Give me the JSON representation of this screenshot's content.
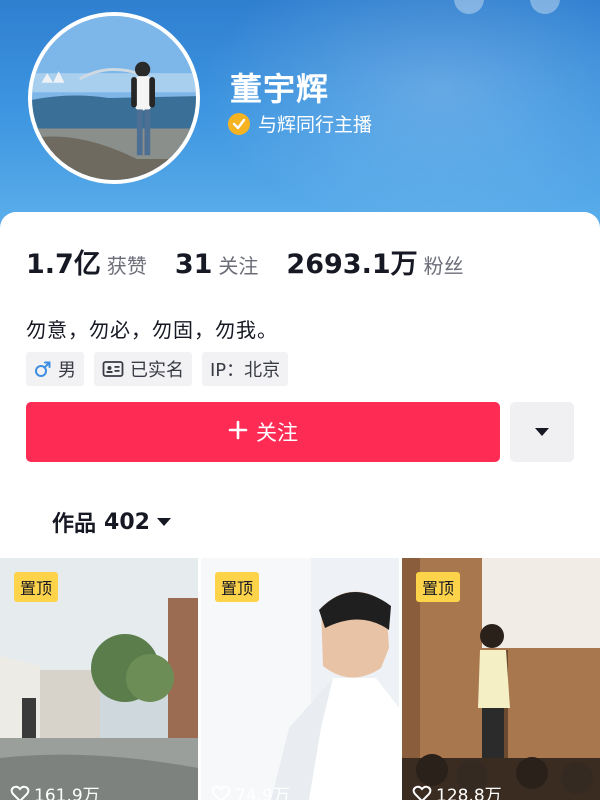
{
  "profile": {
    "name": "董宇辉",
    "verify_text": "与辉同行主播",
    "bio": "勿意，勿必，勿固，勿我。"
  },
  "stats": [
    {
      "num": "1.7亿",
      "label": "获赞"
    },
    {
      "num": "31",
      "label": "关注"
    },
    {
      "num": "2693.1万",
      "label": "粉丝"
    }
  ],
  "tags": [
    {
      "icon": "male-icon",
      "label": "男"
    },
    {
      "icon": "id-card-icon",
      "label": "已实名"
    },
    {
      "icon": "",
      "label": "IP：北京"
    }
  ],
  "actions": {
    "follow_label": "关注",
    "dropdown_icon": "triangle-down-icon"
  },
  "works": {
    "label": "作品",
    "count": "402"
  },
  "videos": [
    {
      "pin": "置顶",
      "likes": "161.9万"
    },
    {
      "pin": "置顶",
      "likes": "74.9万"
    },
    {
      "pin": "置顶",
      "likes": "128.8万"
    }
  ],
  "colors": {
    "accent": "#fe2c55",
    "header": "#3d95e0",
    "verify": "#f5b322",
    "pin": "#fdd34a"
  }
}
